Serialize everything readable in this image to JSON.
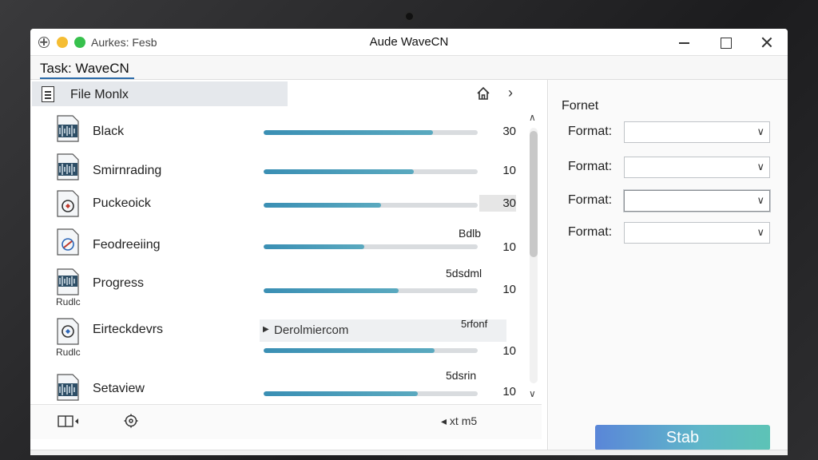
{
  "window": {
    "app_label": "Aurkes: Fesb",
    "title": "Aude WaveCN"
  },
  "task": {
    "title": "Task: WaveCN"
  },
  "file_panel": {
    "title": "File  Monlx",
    "rows": [
      {
        "name": "Black",
        "sub": "",
        "progress": 0.79,
        "value": "30",
        "note": "",
        "value_boxed": false
      },
      {
        "name": "Smirnrading",
        "sub": "",
        "progress": 0.7,
        "value": "10",
        "note": "",
        "value_boxed": false
      },
      {
        "name": "Puckeoick",
        "sub": "",
        "progress": 0.55,
        "value": "30",
        "note": "",
        "value_boxed": true
      },
      {
        "name": "Feodreeiing",
        "sub": "",
        "progress": 0.47,
        "value": "10",
        "note": "Bdlb",
        "value_boxed": false
      },
      {
        "name": "Progress",
        "sub": "Rudlc",
        "progress": 0.63,
        "value": "10",
        "note": "5dsdml",
        "value_boxed": false
      },
      {
        "name": "Eirteckdevrs",
        "sub": "Rudlc",
        "progress": 0.8,
        "value": "10",
        "note": "5rfonf",
        "value_boxed": false,
        "subrow": "Derolmiercom"
      },
      {
        "name": "Setaview",
        "sub": "",
        "progress": 0.72,
        "value": "10",
        "note": "5dsrin",
        "value_boxed": false
      }
    ],
    "footer_nav": "◂  xt m5"
  },
  "format_panel": {
    "title": "Fornet",
    "fields": [
      {
        "label": "Format:",
        "value": ""
      },
      {
        "label": "Format:",
        "value": ""
      },
      {
        "label": "Format:",
        "value": ""
      },
      {
        "label": "Format:",
        "value": ""
      }
    ],
    "action_label": "Stab"
  },
  "colors": {
    "accent": "#3a8fb4",
    "button_start": "#5a86d8",
    "button_end": "#5dc3b6"
  },
  "icons": {
    "file_header": "document-icon",
    "home": "home-icon",
    "next": "chevron-right-icon",
    "footer_left": "panel-toggle-icon",
    "footer_mid": "settings-icon"
  }
}
